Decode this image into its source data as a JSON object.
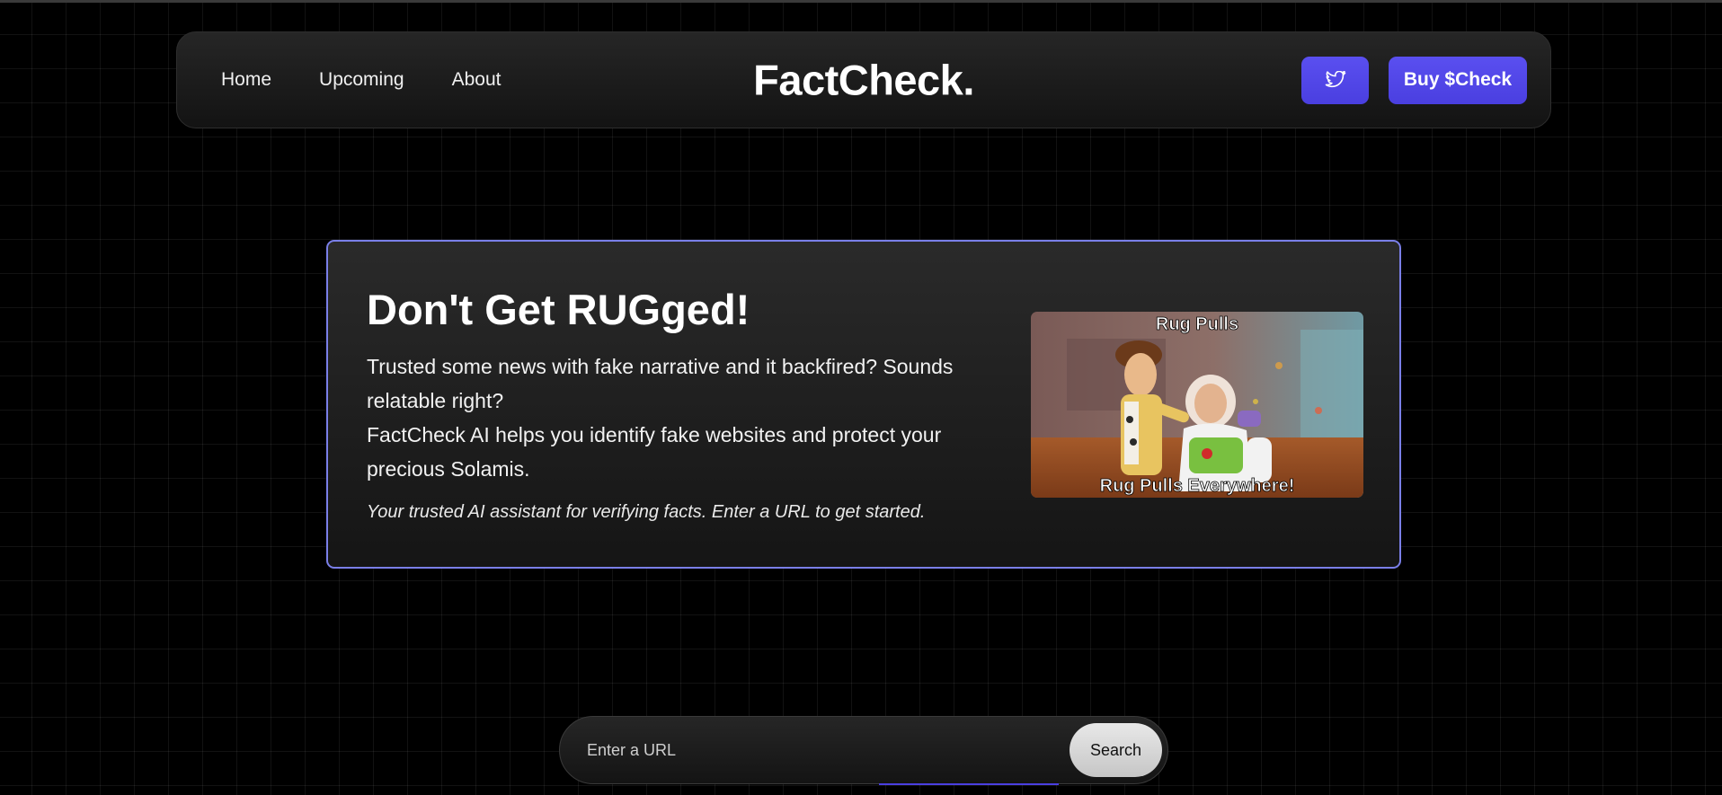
{
  "nav": {
    "links": [
      "Home",
      "Upcoming",
      "About"
    ],
    "brand": "FactCheck.",
    "buy_label": "Buy $Check",
    "twitter_icon": "twitter-icon"
  },
  "hero": {
    "title": "Don't Get RUGged!",
    "desc_line1": "Trusted some news with fake narrative and it backfired? Sounds relatable right?",
    "desc_line2": "FactCheck AI helps you identify fake websites and protect your precious Solamis.",
    "tagline": "Your trusted AI assistant for verifying facts. Enter a URL to get started.",
    "meme": {
      "top_text": "Rug Pulls",
      "bottom_text": "Rug Pulls Everywhere!"
    }
  },
  "search": {
    "placeholder": "Enter a URL",
    "value": "",
    "button_label": "Search"
  },
  "colors": {
    "accent": "#4f46e5",
    "card_border": "#7a7fe8",
    "background": "#000000"
  }
}
